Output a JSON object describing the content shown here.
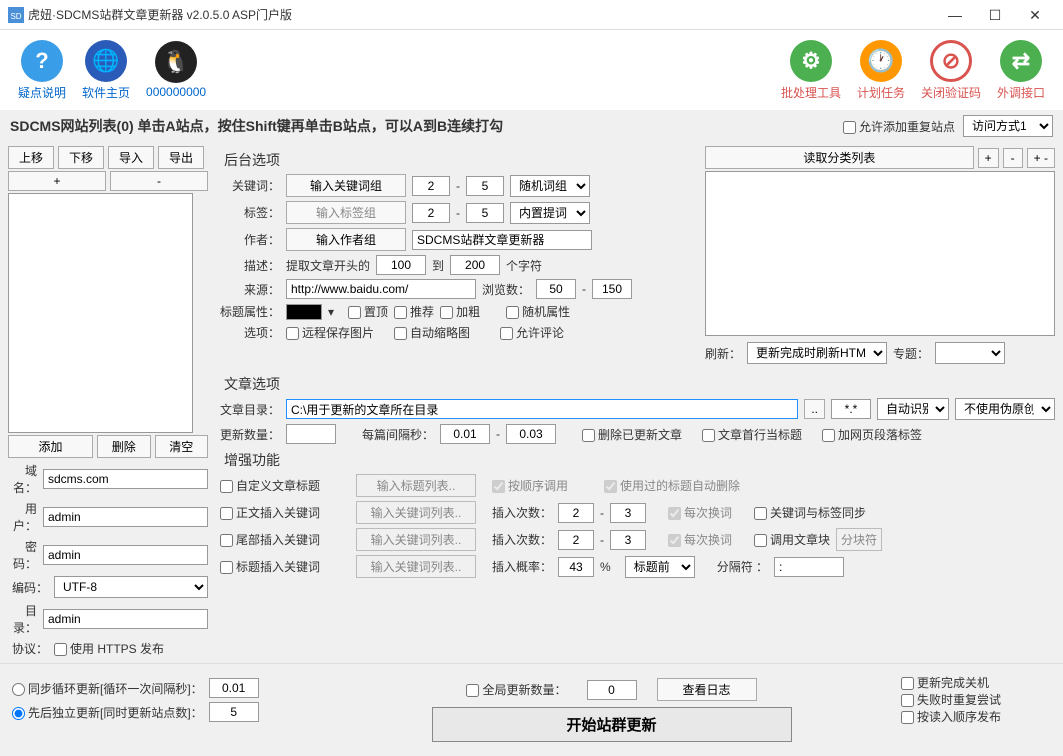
{
  "title": "虎妞·SDCMS站群文章更新器 v2.0.5.0 ASP门户版",
  "toolbar": {
    "help": "疑点说明",
    "home": "软件主页",
    "qq": "000000000",
    "batch": "批处理工具",
    "schedule": "计划任务",
    "closeCaptcha": "关闭验证码",
    "external": "外调接口"
  },
  "listHeader": "SDCMS网站列表(0)  单击A站点，按住Shift键再单击B站点，可以A到B连续打勾",
  "allowDup": "允许添加重复站点",
  "accessMode": "访问方式1",
  "leftBtns": {
    "up": "上移",
    "down": "下移",
    "imp": "导入",
    "exp": "导出",
    "plus": "+",
    "minus": "-",
    "add": "添加",
    "del": "删除",
    "clr": "清空"
  },
  "fields": {
    "domainL": "域名：",
    "domainV": "sdcms.com",
    "userL": "用户：",
    "userV": "admin",
    "passL": "密码：",
    "passV": "admin",
    "encL": "编码：",
    "encV": "UTF-8",
    "dirL": "目录：",
    "dirV": "admin",
    "protoL": "协议：",
    "protoV": "使用 HTTPS 发布"
  },
  "backend": {
    "title": "后台选项",
    "kwL": "关键词：",
    "kwBtn": "输入关键词组",
    "kw1": "2",
    "kw2": "5",
    "kwMode": "随机词组",
    "tagL": "标签：",
    "tagBtn": "输入标签组",
    "tag1": "2",
    "tag2": "5",
    "tagMode": "内置提词",
    "authL": "作者：",
    "authBtn": "输入作者组",
    "authV": "SDCMS站群文章更新器",
    "descL": "描述：",
    "descPre": "提取文章开头的",
    "desc1": "100",
    "descMid": "到",
    "desc2": "200",
    "descSuf": "个字符",
    "srcL": "来源：",
    "srcV": "http://www.baidu.com/",
    "viewL": "浏览数：",
    "view1": "50",
    "view2": "150",
    "titleAttrL": "标题属性：",
    "opt1": "置顶",
    "opt2": "推荐",
    "opt3": "加粗",
    "opt4": "随机属性",
    "selL": "选项：",
    "s1": "远程保存图片",
    "s2": "自动缩略图",
    "s3": "允许评论"
  },
  "catBtn": "读取分类列表",
  "refreshL": "刷新：",
  "refreshV": "更新完成时刷新HTML",
  "topicL": "专题：",
  "article": {
    "title": "文章选项",
    "dirL": "文章目录：",
    "dirV": "C:\\用于更新的文章所在目录",
    "filter": "*.*",
    "enc": "自动识别",
    "pseudo": "不使用伪原创",
    "countL": "更新数量：",
    "intervalL": "每篇间隔秒：",
    "i1": "0.01",
    "i2": "0.03",
    "a1": "删除已更新文章",
    "a2": "文章首行当标题",
    "a3": "加网页段落标签"
  },
  "enhance": {
    "title": "增强功能",
    "e1": "自定义文章标题",
    "e1b": "输入标题列表..",
    "e1c": "按顺序调用",
    "e1d": "使用过的标题自动删除",
    "e2": "正文插入关键词",
    "e2b": "输入关键词列表..",
    "e2c": "插入次数：",
    "e2v1": "2",
    "e2v2": "3",
    "e2d": "每次换词",
    "e2e": "关键词与标签同步",
    "e3": "尾部插入关键词",
    "e3b": "输入关键词列表..",
    "e3c": "插入次数：",
    "e3v1": "2",
    "e3v2": "3",
    "e3d": "每次换词",
    "e3e": "调用文章块",
    "e3f": "分块符",
    "e4": "标题插入关键词",
    "e4b": "输入关键词列表..",
    "e4c": "插入概率：",
    "e4v": "43",
    "e4p": "%",
    "e4pos": "标题前",
    "e4sep": "分隔符 ：",
    "e4sv": ":"
  },
  "footer": {
    "r1": "同步循环更新[循环一次间隔秒]：",
    "r1v": "0.01",
    "r2": "先后独立更新[同时更新站点数]：",
    "r2v": "5",
    "g1": "全局更新数量：",
    "g1v": "0",
    "g2": "查看日志",
    "start": "开始站群更新",
    "o1": "更新完成关机",
    "o2": "失败时重复尝试",
    "o3": "按读入顺序发布"
  }
}
